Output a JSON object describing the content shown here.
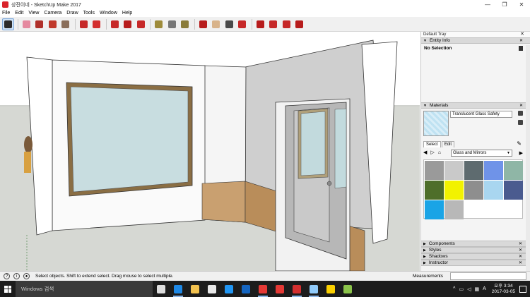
{
  "window": {
    "title": "상진이네 - SketchUp Make 2017",
    "controls": [
      "—",
      "❐",
      "✕"
    ]
  },
  "menu": [
    "File",
    "Edit",
    "View",
    "Camera",
    "Draw",
    "Tools",
    "Window",
    "Help"
  ],
  "toolbar": {
    "tools": [
      {
        "name": "select-tool-icon",
        "color": "#2b2b2b",
        "active": true
      },
      {
        "name": "eraser-tool-icon",
        "color": "#e58aa0"
      },
      {
        "name": "line-tool-icon",
        "color": "#b0302a"
      },
      {
        "name": "arc-tool-icon",
        "color": "#c0392b"
      },
      {
        "name": "rectangle-tool-icon",
        "color": "#8a6e5a"
      },
      {
        "name": "push-pull-tool-icon",
        "color": "#c62828"
      },
      {
        "name": "offset-tool-icon",
        "color": "#d32f2f"
      },
      {
        "name": "move-tool-icon",
        "color": "#c62828"
      },
      {
        "name": "rotate-tool-icon",
        "color": "#b71c1c"
      },
      {
        "name": "scale-tool-icon",
        "color": "#c62828"
      },
      {
        "name": "tape-measure-tool-icon",
        "color": "#9e8b3a"
      },
      {
        "name": "text-tool-icon",
        "color": "#777777"
      },
      {
        "name": "paint-bucket-tool-icon",
        "color": "#8a7c3a"
      },
      {
        "name": "orbit-tool-icon",
        "color": "#b71c1c"
      },
      {
        "name": "pan-tool-icon",
        "color": "#d8b38a"
      },
      {
        "name": "zoom-tool-icon",
        "color": "#4a4a4a"
      },
      {
        "name": "zoom-extents-tool-icon",
        "color": "#c62828"
      },
      {
        "name": "warehouse-icon",
        "color": "#b71c1c"
      },
      {
        "name": "extension-warehouse-icon",
        "color": "#c62828"
      },
      {
        "name": "share-model-icon",
        "color": "#c62828"
      },
      {
        "name": "extension-manager-icon",
        "color": "#b71c1c"
      }
    ]
  },
  "tray": {
    "title": "Default Tray",
    "entity_info": {
      "label": "Entity Info",
      "selection": "No Selection"
    },
    "materials": {
      "label": "Materials",
      "current": "Translucent Glass Safety",
      "tabs": [
        "Select",
        "Edit"
      ],
      "library": "Glass and Mirrors",
      "swatches": [
        "#9a9a9a",
        "#c9c9c9",
        "#5e6b6f",
        "#6f93e8",
        "#8fb6a6",
        "#4e6e2a",
        "#f2f200",
        "#8e8e8e",
        "#a9d6f0",
        "#4a5b8f",
        "#1aa4e6",
        "#b8b8b8"
      ]
    },
    "collapsed": [
      "Components",
      "Styles",
      "Shadows",
      "Instructor"
    ]
  },
  "status": {
    "message": "Select objects. Shift to extend select. Drag mouse to select multiple.",
    "measurements_label": "Measurements"
  },
  "taskbar": {
    "search_placeholder": "Windows 검색",
    "apps": [
      {
        "name": "task-view-icon",
        "color": "#dddddd"
      },
      {
        "name": "edge-icon",
        "color": "#1e88e5",
        "running": true
      },
      {
        "name": "file-explorer-icon",
        "color": "#f2c14e"
      },
      {
        "name": "store-icon",
        "color": "#e8e8e8"
      },
      {
        "name": "ie-icon",
        "color": "#2196f3"
      },
      {
        "name": "media-player-icon",
        "color": "#1565c0"
      },
      {
        "name": "chrome-icon",
        "color": "#e53935",
        "running": true
      },
      {
        "name": "sketchup-layout-icon",
        "color": "#e53935"
      },
      {
        "name": "sketchup-icon",
        "color": "#d32f2f",
        "running": true
      },
      {
        "name": "app-blue-icon",
        "color": "#90caf9",
        "running": true
      },
      {
        "name": "kakaotalk-icon",
        "color": "#fbd000"
      },
      {
        "name": "paint-icon",
        "color": "#8bc34a"
      }
    ],
    "clock_time": "오후 3:34",
    "clock_date": "2017-03-05"
  }
}
